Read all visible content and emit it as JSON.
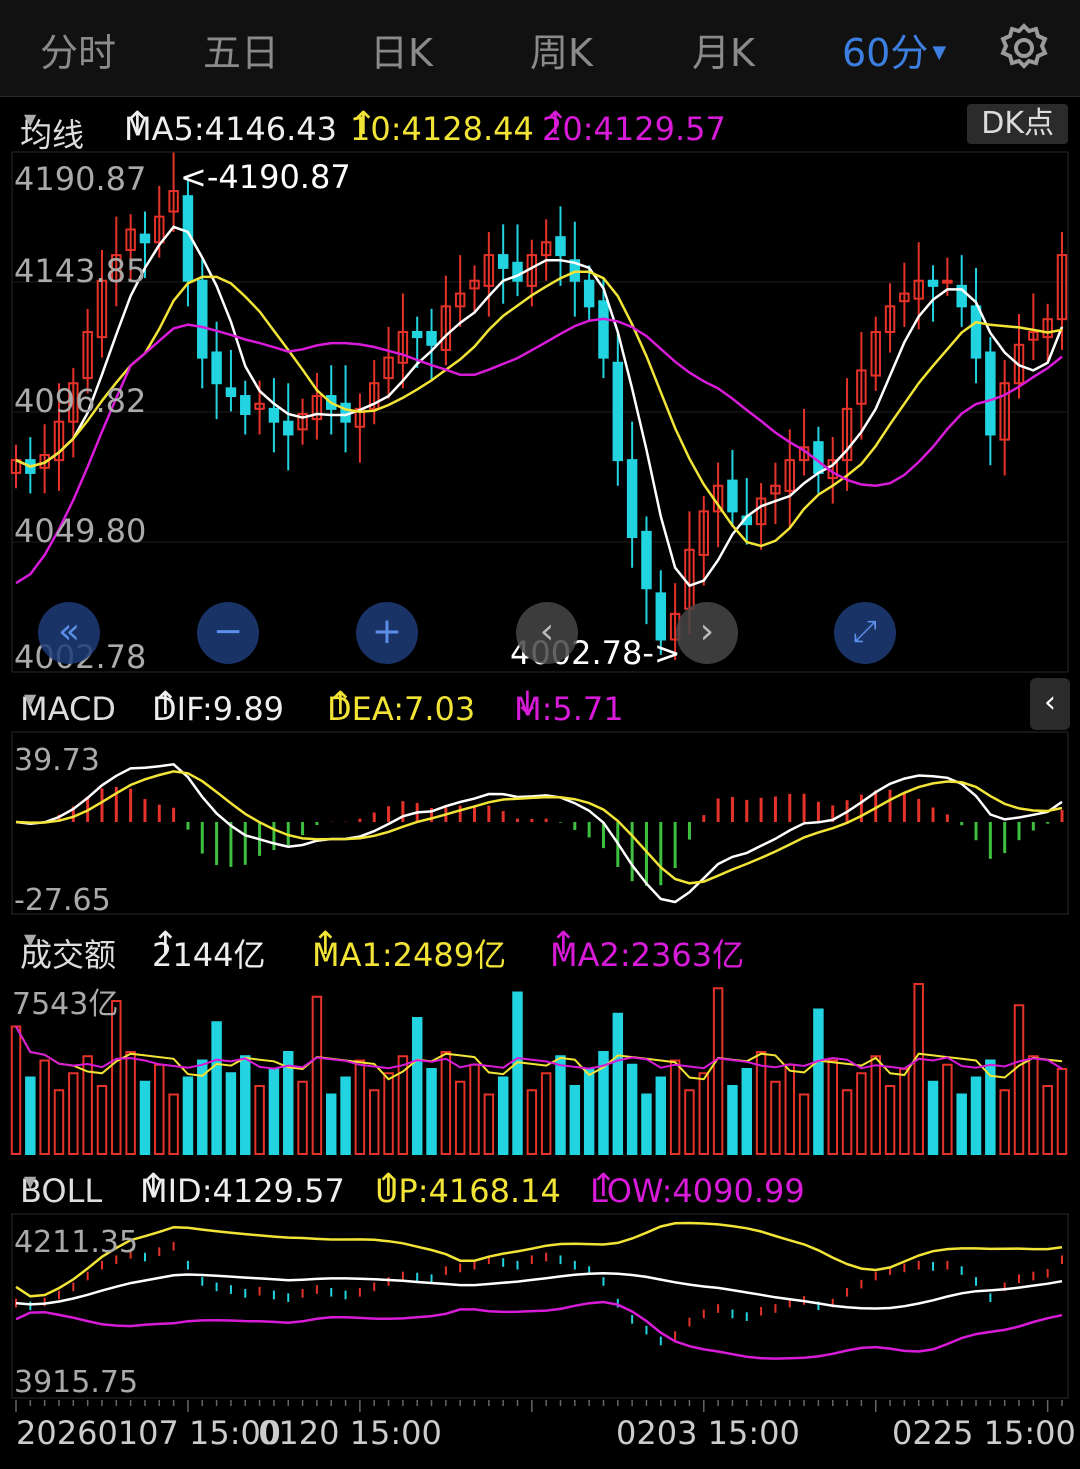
{
  "tabs": [
    {
      "label": "分时",
      "active": false
    },
    {
      "label": "五日",
      "active": false
    },
    {
      "label": "日K",
      "active": false
    },
    {
      "label": "周K",
      "active": false
    },
    {
      "label": "月K",
      "active": false
    },
    {
      "label": "60分",
      "active": true
    }
  ],
  "settings_icon": "gear-icon",
  "ma_header": {
    "selector": "均线",
    "ma5": "MA5:4146.43",
    "ma10": "10:4128.44",
    "ma20": "20:4129.57",
    "dk_button": "DK点"
  },
  "price_chart": {
    "y_ticks": [
      "4190.87",
      "4143.85",
      "4096.82",
      "4049.80",
      "4002.78"
    ],
    "high_label": "<-4190.87",
    "low_label": "4002.78->"
  },
  "macd_header": {
    "selector": "MACD",
    "dif": "DIF:9.89",
    "dea": "DEA:7.03",
    "m": "M:5.71"
  },
  "macd_chart": {
    "y_max": "39.73",
    "y_min": "-27.65"
  },
  "volume_header": {
    "selector": "成交额",
    "value": "2144亿",
    "ma1": "MA1:2489亿",
    "ma2": "MA2:2363亿"
  },
  "volume_chart": {
    "y_max": "7543亿"
  },
  "boll_header": {
    "selector": "BOLL",
    "mid": "MID:4129.57",
    "up": "UP:4168.14",
    "low": "LOW:4090.99"
  },
  "boll_chart": {
    "y_max": "4211.35",
    "y_min": "3915.75"
  },
  "dates": [
    "20260107 15:00",
    "0120 15:00",
    "0203 15:00",
    "0225 15:00"
  ],
  "colors": {
    "up": "#e5332a",
    "down": "#22d3e0",
    "ma5": "#ffffff",
    "ma10": "#f2e436",
    "ma20": "#d81bd8",
    "active_tab": "#3d7fe0"
  },
  "chart_data": {
    "type": "candlestick",
    "y_range": [
      4002.78,
      4190.87
    ],
    "high": 4190.87,
    "low": 4002.78,
    "close_series": [
      4080,
      4075,
      4082,
      4095,
      4110,
      4130,
      4150,
      4160,
      4170,
      4165,
      4175,
      4185,
      4150,
      4120,
      4110,
      4105,
      4098,
      4102,
      4095,
      4090,
      4098,
      4105,
      4100,
      4095,
      4100,
      4110,
      4120,
      4130,
      4128,
      4125,
      4140,
      4145,
      4150,
      4160,
      4155,
      4150,
      4160,
      4165,
      4160,
      4150,
      4140,
      4120,
      4080,
      4050,
      4030,
      4010,
      4020,
      4045,
      4060,
      4070,
      4060,
      4055,
      4065,
      4070,
      4080,
      4085,
      4075,
      4080,
      4100,
      4115,
      4130,
      4140,
      4145,
      4150,
      4148,
      4150,
      4140,
      4120,
      4090,
      4110,
      4125,
      4130,
      4135,
      4160
    ]
  }
}
